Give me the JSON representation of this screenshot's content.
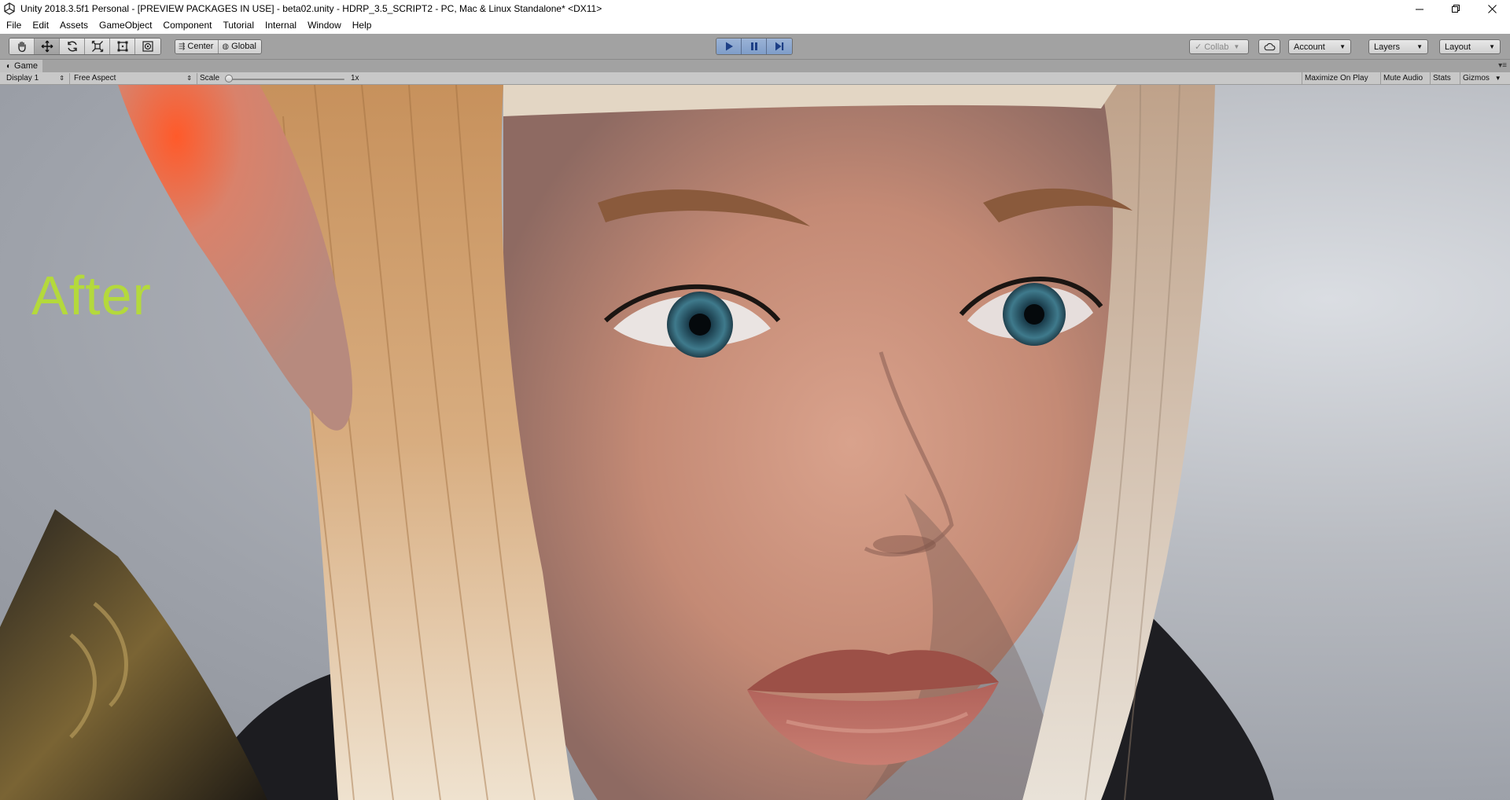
{
  "window": {
    "title": "Unity 2018.3.5f1 Personal - [PREVIEW PACKAGES IN USE] - beta02.unity - HDRP_3.5_SCRIPT2 - PC, Mac & Linux Standalone* <DX11>",
    "app_icon": "unity-logo-icon",
    "controls": [
      "minimize-icon",
      "restore-icon",
      "close-icon"
    ]
  },
  "menu": {
    "items": [
      "File",
      "Edit",
      "Assets",
      "GameObject",
      "Component",
      "Tutorial",
      "Internal",
      "Window",
      "Help"
    ]
  },
  "toolbar": {
    "tools": [
      "hand-tool-icon",
      "move-tool-icon",
      "rotate-tool-icon",
      "scale-tool-icon",
      "rect-tool-icon",
      "transform-tool-icon"
    ],
    "active_tool": "move-tool-icon",
    "pivot_mode": "Center",
    "pivot_space": "Global",
    "playback": [
      "play-icon",
      "pause-icon",
      "step-icon"
    ],
    "collab": "Collab",
    "cloud_icon": "cloud-icon",
    "account": "Account",
    "layers": "Layers",
    "layout": "Layout",
    "accent_color": "#7f9dc9"
  },
  "game_view": {
    "tab_label": "Game",
    "display": "Display 1",
    "aspect": "Free Aspect",
    "scale_label": "Scale",
    "scale_value": "1x",
    "scale_level": 0.0,
    "toggles": {
      "maximize": "Maximize On Play",
      "mute": "Mute Audio",
      "stats": "Stats",
      "gizmos": "Gizmos"
    },
    "overlay_text": "After",
    "overlay_color": "#b4d93c"
  }
}
